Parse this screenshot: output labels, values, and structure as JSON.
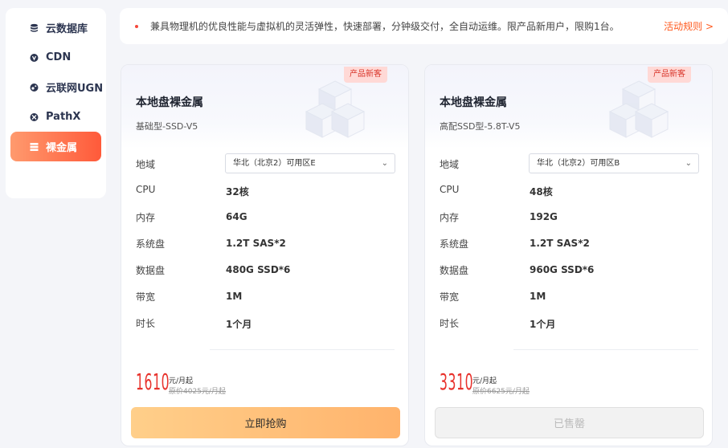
{
  "sidebar": {
    "items": [
      {
        "label": "云数据库",
        "icon": "database-icon"
      },
      {
        "label": "CDN",
        "icon": "cdn-icon"
      },
      {
        "label": "云联网UGN",
        "icon": "network-icon"
      },
      {
        "label": "PathX",
        "icon": "pathx-icon"
      },
      {
        "label": "裸金属",
        "icon": "server-icon",
        "active": true
      }
    ]
  },
  "notice": {
    "text": "兼具物理机的优良性能与虚拟机的灵活弹性，快速部署，分钟级交付，全自动运维。限产品新用户，限购1台。",
    "link": "活动规则 >"
  },
  "colors": {
    "accent": "#ff5a3a",
    "price": "#e8322c",
    "badge_bg": "#ffd9d6"
  },
  "products": [
    {
      "badge": "产品新客",
      "title": "本地盘裸金属",
      "subtitle": "基础型-SSD-V5",
      "specs": {
        "region_label": "地域",
        "region_value": "华北（北京2）可用区E",
        "cpu_label": "CPU",
        "cpu_value": "32核",
        "mem_label": "内存",
        "mem_value": "64G",
        "sysdisk_label": "系统盘",
        "sysdisk_value": "1.2T SAS*2",
        "datadisk_label": "数据盘",
        "datadisk_value": "480G SSD*6",
        "bw_label": "带宽",
        "bw_value": "1M",
        "duration_label": "时长",
        "duration_value": "1个月"
      },
      "price": "1610",
      "price_unit": "元/月起",
      "original_price": "原价4025元/月起",
      "button": "立即抢购"
    },
    {
      "badge": "产品新客",
      "title": "本地盘裸金属",
      "subtitle": "高配SSD型-5.8T-V5",
      "specs": {
        "region_label": "地域",
        "region_value": "华北（北京2）可用区B",
        "cpu_label": "CPU",
        "cpu_value": "48核",
        "mem_label": "内存",
        "mem_value": "192G",
        "sysdisk_label": "系统盘",
        "sysdisk_value": "1.2T SAS*2",
        "datadisk_label": "数据盘",
        "datadisk_value": "960G SSD*6",
        "bw_label": "带宽",
        "bw_value": "1M",
        "duration_label": "时长",
        "duration_value": "1个月"
      },
      "price": "3310",
      "price_unit": "元/月起",
      "original_price": "原价6625元/月起",
      "button": "已售罄"
    }
  ]
}
